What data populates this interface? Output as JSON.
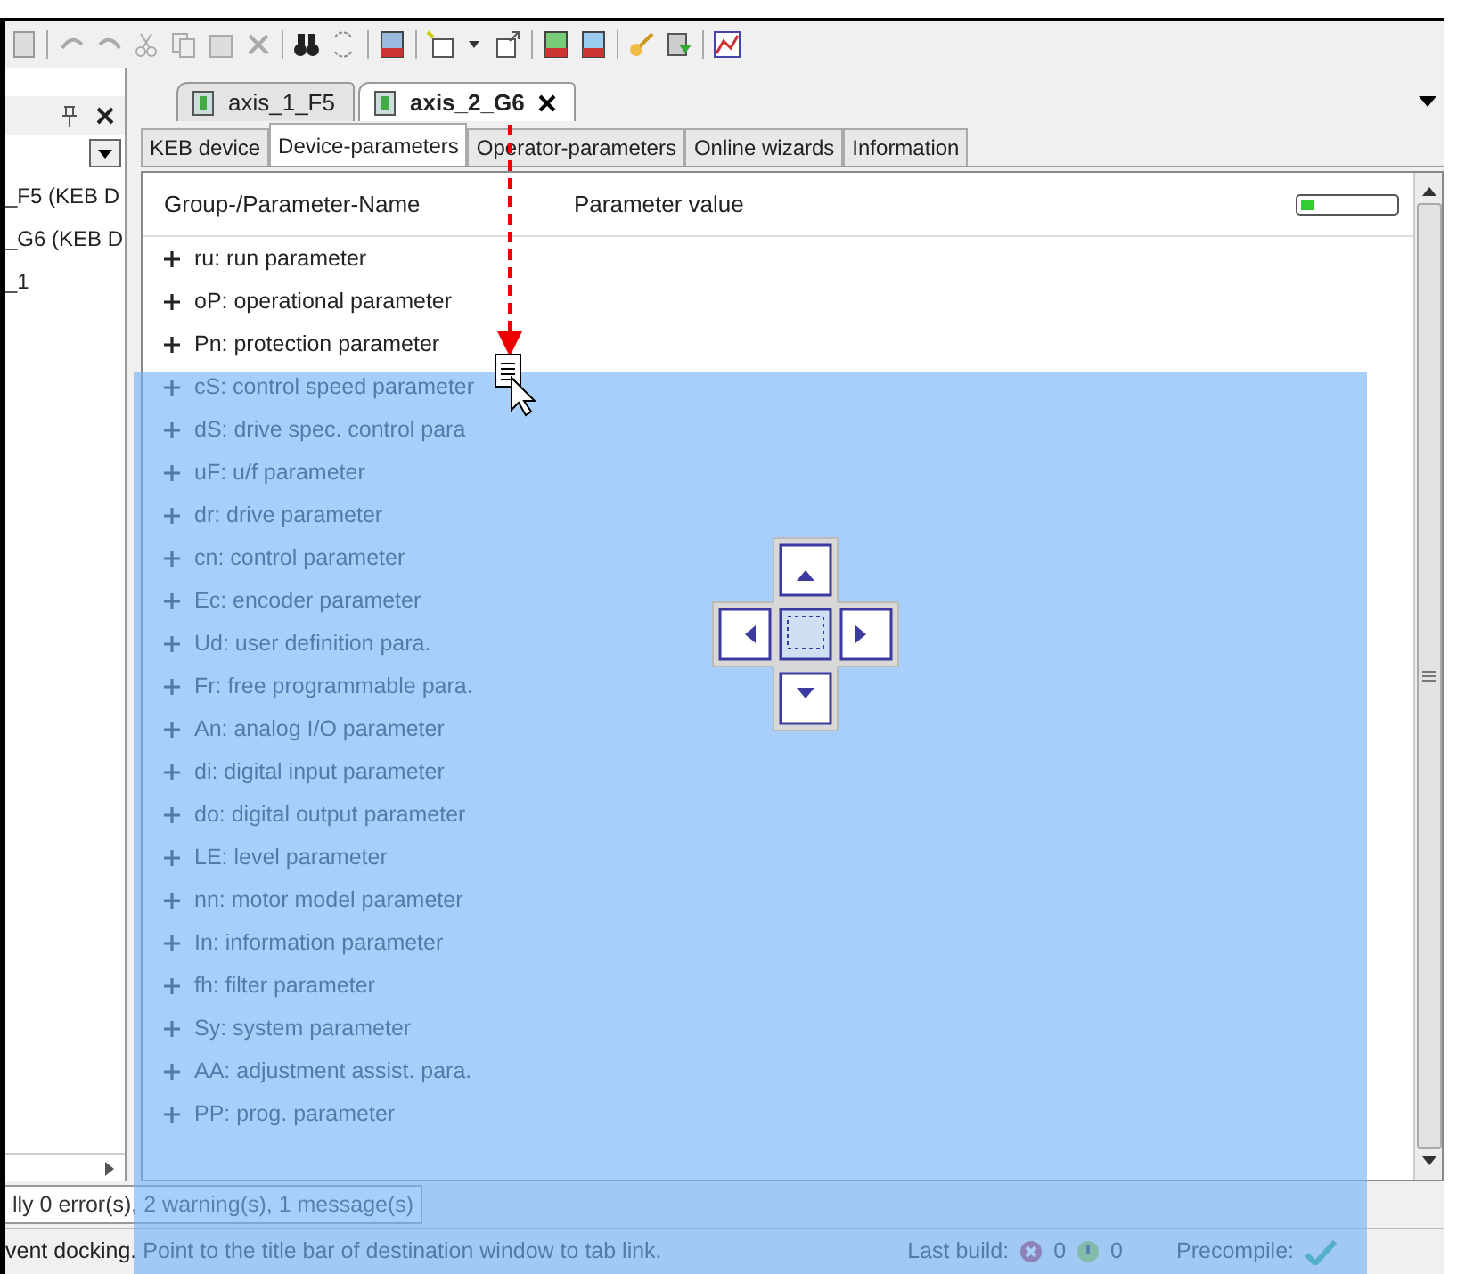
{
  "left_panel": {
    "items": [
      "_F5 (KEB D",
      "_G6 (KEB D",
      "_1"
    ]
  },
  "document_tabs": [
    {
      "label": "axis_1_F5",
      "selected": false
    },
    {
      "label": "axis_2_G6",
      "selected": true
    }
  ],
  "sub_tabs": [
    {
      "label": "KEB device",
      "selected": false
    },
    {
      "label": "Device-parameters",
      "selected": true
    },
    {
      "label": "Operator-parameters",
      "selected": false
    },
    {
      "label": "Online wizards",
      "selected": false
    },
    {
      "label": "Information",
      "selected": false
    }
  ],
  "tree": {
    "columns": [
      "Group-/Parameter-Name",
      "Parameter value"
    ],
    "rows": [
      {
        "label": "ru: run parameter",
        "expanded": false
      },
      {
        "label": "oP: operational parameter",
        "expanded": false
      },
      {
        "label": "Pn: protection parameter",
        "expanded": false
      },
      {
        "label": "cS: control speed parameter",
        "expanded": false
      },
      {
        "label": "dS: drive spec. control para",
        "expanded": false
      },
      {
        "label": "uF: u/f parameter",
        "expanded": false
      },
      {
        "label": "dr: drive parameter",
        "expanded": false
      },
      {
        "label": "cn: control parameter",
        "expanded": false
      },
      {
        "label": "Ec: encoder parameter",
        "expanded": false
      },
      {
        "label": "Ud: user definition para.",
        "expanded": false
      },
      {
        "label": "Fr: free programmable para.",
        "expanded": false
      },
      {
        "label": "An: analog I/O parameter",
        "expanded": false
      },
      {
        "label": "di: digital input parameter",
        "expanded": false
      },
      {
        "label": "do: digital output parameter",
        "expanded": false
      },
      {
        "label": "LE: level parameter",
        "expanded": false
      },
      {
        "label": "nn: motor model parameter",
        "expanded": false
      },
      {
        "label": "In: information parameter",
        "expanded": false
      },
      {
        "label": "fh: filter parameter",
        "expanded": false
      },
      {
        "label": "Sy: system parameter",
        "expanded": false
      },
      {
        "label": "AA: adjustment assist. para.",
        "expanded": false
      },
      {
        "label": "PP: prog. parameter",
        "expanded": false
      }
    ]
  },
  "output_tab": "lly 0 error(s), 2 warning(s), 1 message(s)",
  "status_bar": {
    "message": "vent docking. Point to the title bar of destination window to tab link.",
    "last_build_label": "Last build:",
    "errors": "0",
    "warnings": "0",
    "precompile_label": "Precompile:"
  }
}
